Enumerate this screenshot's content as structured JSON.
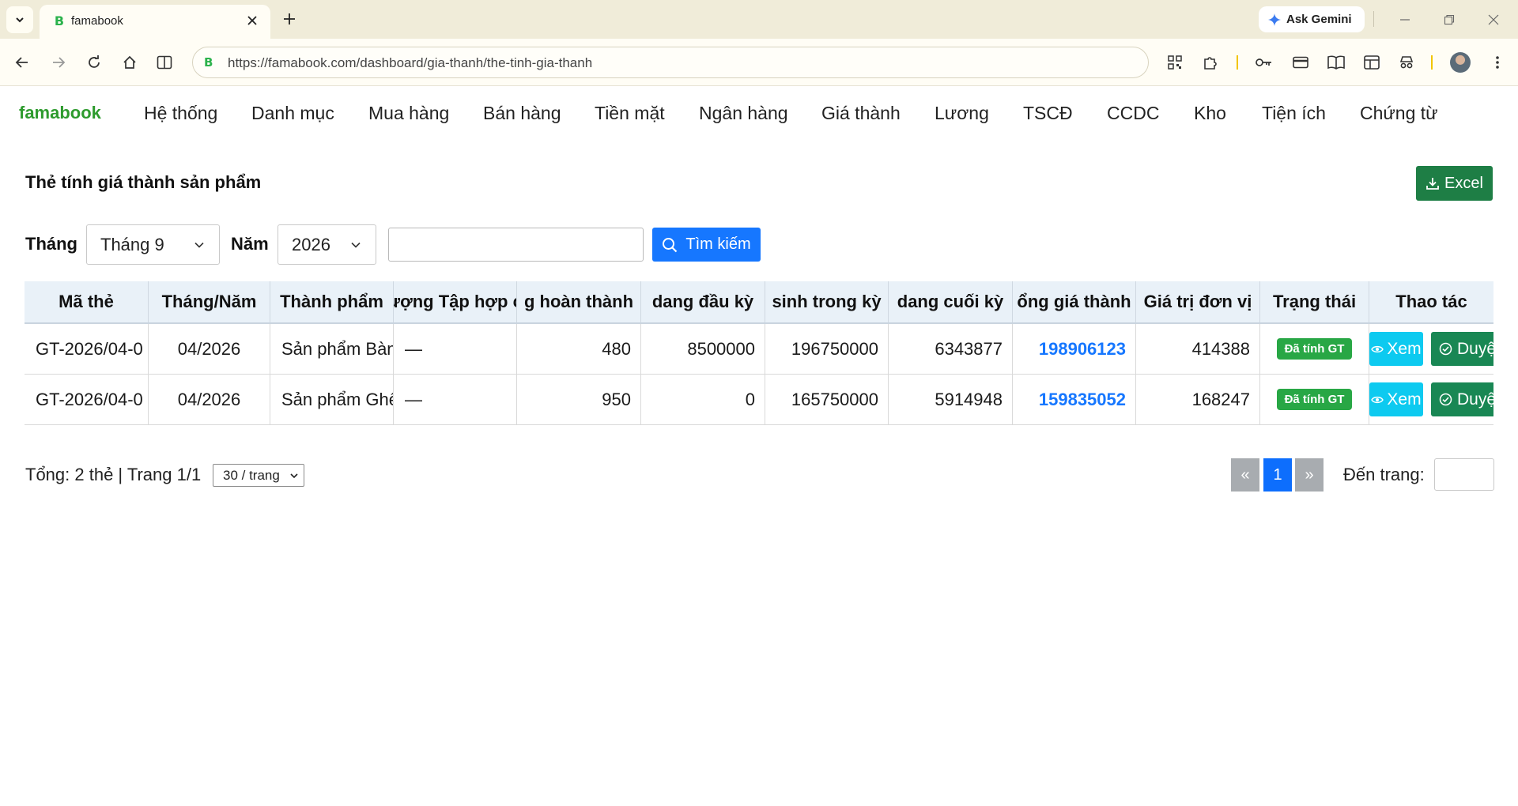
{
  "browser": {
    "tab_title": "famabook",
    "tab_favicon": "B",
    "url": "https://famabook.com/dashboard/gia-thanh/the-tinh-gia-thanh",
    "gemini_label": "Ask Gemini"
  },
  "app": {
    "brand": "famabook",
    "menu": [
      "Hệ thống",
      "Danh mục",
      "Mua hàng",
      "Bán hàng",
      "Tiền mặt",
      "Ngân hàng",
      "Giá thành",
      "Lương",
      "TSCĐ",
      "CCDC",
      "Kho",
      "Tiện ích",
      "Chứng từ"
    ]
  },
  "page": {
    "title": "Thẻ tính giá thành sản phẩm",
    "excel_label": "Excel"
  },
  "filters": {
    "month_label": "Tháng",
    "month_value": "Tháng 9",
    "year_label": "Năm",
    "year_value": "2026",
    "search_value": "",
    "search_button": "Tìm kiếm"
  },
  "table": {
    "headers": [
      "Mã thẻ",
      "Tháng/Năm",
      "Thành phẩm",
      "ượng Tập hợp c",
      "g hoàn thành",
      "dang đầu kỳ",
      "sinh trong kỳ",
      "dang cuối kỳ",
      "ổng giá thành",
      "Giá trị đơn vị",
      "Trạng thái",
      "Thao tác"
    ],
    "rows": [
      {
        "ma_the": "GT-2026/04-0",
        "thang_nam": "04/2026",
        "thanh_pham": "Sản phẩm Bàn",
        "doi_tuong": "—",
        "sl_hoan_thanh": "480",
        "dd_dau_ky": "8500000",
        "ps_trong_ky": "196750000",
        "dd_cuoi_ky": "6343877",
        "tong_gia_thanh": "198906123",
        "gia_tri_don_vi": "414388",
        "trang_thai": "Đã tính GT",
        "view_label": "Xem",
        "approve_label": "Duyệt"
      },
      {
        "ma_the": "GT-2026/04-0",
        "thang_nam": "04/2026",
        "thanh_pham": "Sản phẩm Ghế",
        "doi_tuong": "—",
        "sl_hoan_thanh": "950",
        "dd_dau_ky": "0",
        "ps_trong_ky": "165750000",
        "dd_cuoi_ky": "5914948",
        "tong_gia_thanh": "159835052",
        "gia_tri_don_vi": "168247",
        "trang_thai": "Đã tính GT",
        "view_label": "Xem",
        "approve_label": "Duyệt"
      }
    ]
  },
  "footer": {
    "summary": "Tổng: 2 thẻ | Trang 1/1",
    "page_size": "30 / trang",
    "prev": "«",
    "current_page": "1",
    "next": "»",
    "goto_label": "Đến trang:",
    "goto_value": ""
  },
  "colors": {
    "brand": "#2e9b2e",
    "primary": "#1677ff",
    "excel": "#1e7e45",
    "badge": "#28a745",
    "view": "#0dcaf0",
    "approve": "#198754"
  }
}
